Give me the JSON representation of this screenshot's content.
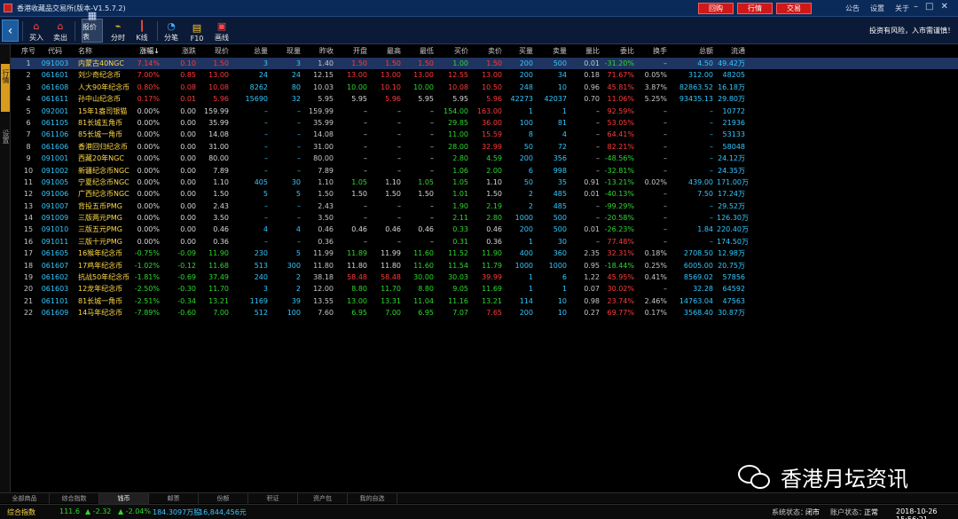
{
  "window": {
    "title": "香港收藏品交易所(版本-V1.5.7.2)",
    "top_buttons": [
      "回购",
      "行情",
      "交易"
    ],
    "menu_links": [
      "公告",
      "设置",
      "关于"
    ],
    "controls": [
      "–",
      "□",
      "✕"
    ]
  },
  "toolbar": {
    "back": "‹",
    "tools": [
      {
        "label": "买入",
        "icon": "buy-icon",
        "glyph": "⌂"
      },
      {
        "label": "卖出",
        "icon": "sell-icon",
        "glyph": "⌂"
      },
      {
        "label": "报价表",
        "icon": "quote-table-icon",
        "glyph": "▦"
      },
      {
        "label": "分时",
        "icon": "timeshare-icon",
        "glyph": "⌁"
      },
      {
        "label": "K线",
        "icon": "kline-icon",
        "glyph": "┃"
      },
      {
        "label": "分笔",
        "icon": "tick-icon",
        "glyph": "◔"
      },
      {
        "label": "F10",
        "icon": "f10-icon",
        "glyph": "▤"
      },
      {
        "label": "画线",
        "icon": "draw-line-icon",
        "glyph": "▣"
      }
    ],
    "risk_note": "投资有风险，入市需谨慎！"
  },
  "side_tabs": [
    "行情",
    "设置"
  ],
  "table": {
    "headers": [
      "序号",
      "代码",
      "名称",
      "涨幅↓",
      "涨跌",
      "现价",
      "总量",
      "现量",
      "昨收",
      "开盘",
      "最高",
      "最低",
      "买价",
      "卖价",
      "买量",
      "卖量",
      "量比",
      "委比",
      "换手",
      "总额",
      "流通"
    ],
    "rows": [
      [
        "1",
        "091003",
        "内蒙古40NGC",
        "7.14%",
        "0.10",
        "1.50",
        "3",
        "3",
        "1.40",
        "1.50",
        "1.50",
        "1.50",
        "1.00",
        "1.50",
        "200",
        "500",
        "0.01",
        "-31.20%",
        "–",
        "4.50",
        "49.42万"
      ],
      [
        "2",
        "061601",
        "刘少奇纪念币",
        "7.00%",
        "0.85",
        "13.00",
        "24",
        "24",
        "12.15",
        "13.00",
        "13.00",
        "13.00",
        "12.55",
        "13.00",
        "200",
        "34",
        "0.18",
        "71.67%",
        "0.05%",
        "312.00",
        "48205"
      ],
      [
        "3",
        "061608",
        "人大90年纪念币",
        "0.80%",
        "0.08",
        "10.08",
        "8262",
        "80",
        "10.03",
        "10.00",
        "10.10",
        "10.00",
        "10.08",
        "10.50",
        "248",
        "10",
        "0.96",
        "45.81%",
        "3.87%",
        "82863.52",
        "16.18万"
      ],
      [
        "4",
        "061611",
        "孙中山纪念币",
        "0.17%",
        "0.01",
        "5.96",
        "15690",
        "32",
        "5.95",
        "5.95",
        "5.96",
        "5.95",
        "5.95",
        "5.96",
        "42273",
        "42037",
        "0.70",
        "11.06%",
        "5.25%",
        "93435.13",
        "29.80万"
      ],
      [
        "5",
        "092001",
        "15年1盎司银猫",
        "0.00%",
        "0.00",
        "159.99",
        "–",
        "–",
        "159.99",
        "–",
        "–",
        "–",
        "154.00",
        "163.00",
        "1",
        "1",
        "–",
        "92.59%",
        "–",
        "–",
        "10772"
      ],
      [
        "6",
        "061105",
        "81长城五角币",
        "0.00%",
        "0.00",
        "35.99",
        "–",
        "–",
        "35.99",
        "–",
        "–",
        "–",
        "29.85",
        "36.00",
        "100",
        "81",
        "–",
        "53.05%",
        "–",
        "–",
        "21936"
      ],
      [
        "7",
        "061106",
        "85长城一角币",
        "0.00%",
        "0.00",
        "14.08",
        "–",
        "–",
        "14.08",
        "–",
        "–",
        "–",
        "11.00",
        "15.59",
        "8",
        "4",
        "–",
        "64.41%",
        "–",
        "–",
        "53133"
      ],
      [
        "8",
        "061606",
        "香港回归纪念币",
        "0.00%",
        "0.00",
        "31.00",
        "–",
        "–",
        "31.00",
        "–",
        "–",
        "–",
        "28.00",
        "32.99",
        "50",
        "72",
        "–",
        "82.21%",
        "–",
        "–",
        "58048"
      ],
      [
        "9",
        "091001",
        "西藏20年NGC",
        "0.00%",
        "0.00",
        "80.00",
        "–",
        "–",
        "80.00",
        "–",
        "–",
        "–",
        "2.80",
        "4.59",
        "200",
        "356",
        "–",
        "-48.56%",
        "–",
        "–",
        "24.12万"
      ],
      [
        "10",
        "091002",
        "新疆纪念币NGC",
        "0.00%",
        "0.00",
        "7.89",
        "–",
        "–",
        "7.89",
        "–",
        "–",
        "–",
        "1.06",
        "2.00",
        "6",
        "998",
        "–",
        "-32.81%",
        "–",
        "–",
        "24.35万"
      ],
      [
        "11",
        "091005",
        "宁夏纪念币NGC",
        "0.00%",
        "0.00",
        "1.10",
        "405",
        "30",
        "1.10",
        "1.05",
        "1.10",
        "1.05",
        "1.05",
        "1.10",
        "50",
        "35",
        "0.91",
        "-13.21%",
        "0.02%",
        "439.00",
        "171.00万"
      ],
      [
        "12",
        "091006",
        "广西纪念币NGC",
        "0.00%",
        "0.00",
        "1.50",
        "5",
        "5",
        "1.50",
        "1.50",
        "1.50",
        "1.50",
        "1.01",
        "1.50",
        "2",
        "485",
        "0.01",
        "-40.13%",
        "–",
        "7.50",
        "17.24万"
      ],
      [
        "13",
        "091007",
        "背投五币PMG",
        "0.00%",
        "0.00",
        "2.43",
        "–",
        "–",
        "2.43",
        "–",
        "–",
        "–",
        "1.90",
        "2.19",
        "2",
        "485",
        "–",
        "-99.29%",
        "–",
        "–",
        "29.52万"
      ],
      [
        "14",
        "091009",
        "三版两元PMG",
        "0.00%",
        "0.00",
        "3.50",
        "–",
        "–",
        "3.50",
        "–",
        "–",
        "–",
        "2.11",
        "2.80",
        "1000",
        "500",
        "–",
        "-20.58%",
        "–",
        "–",
        "126.30万"
      ],
      [
        "15",
        "091010",
        "三版五元PMG",
        "0.00%",
        "0.00",
        "0.46",
        "4",
        "4",
        "0.46",
        "0.46",
        "0.46",
        "0.46",
        "0.33",
        "0.46",
        "200",
        "500",
        "0.01",
        "-26.23%",
        "–",
        "1.84",
        "220.40万"
      ],
      [
        "16",
        "091011",
        "三版十元PMG",
        "0.00%",
        "0.00",
        "0.36",
        "–",
        "–",
        "0.36",
        "–",
        "–",
        "–",
        "0.31",
        "0.36",
        "1",
        "30",
        "–",
        "77.48%",
        "–",
        "–",
        "174.50万"
      ],
      [
        "17",
        "061605",
        "16猴年纪念币",
        "-0.75%",
        "-0.09",
        "11.90",
        "230",
        "5",
        "11.99",
        "11.89",
        "11.99",
        "11.60",
        "11.52",
        "11.90",
        "400",
        "360",
        "2.35",
        "32.31%",
        "0.18%",
        "2708.50",
        "12.98万"
      ],
      [
        "18",
        "061607",
        "17鸡年纪念币",
        "-1.02%",
        "-0.12",
        "11.68",
        "513",
        "300",
        "11.80",
        "11.80",
        "11.80",
        "11.60",
        "11.54",
        "11.79",
        "1000",
        "1000",
        "0.95",
        "-18.44%",
        "0.25%",
        "6005.00",
        "20.75万"
      ],
      [
        "19",
        "061602",
        "抗战50年纪念币",
        "-1.81%",
        "-0.69",
        "37.49",
        "240",
        "2",
        "38.18",
        "58.48",
        "58.48",
        "30.00",
        "30.03",
        "39.99",
        "1",
        "6",
        "1.22",
        "45.95%",
        "0.41%",
        "8569.02",
        "57856"
      ],
      [
        "20",
        "061603",
        "12龙年纪念币",
        "-2.50%",
        "-0.30",
        "11.70",
        "3",
        "2",
        "12.00",
        "8.80",
        "11.70",
        "8.80",
        "9.05",
        "11.69",
        "1",
        "1",
        "0.07",
        "30.02%",
        "–",
        "32.28",
        "64592"
      ],
      [
        "21",
        "061101",
        "81长城一角币",
        "-2.51%",
        "-0.34",
        "13.21",
        "1169",
        "39",
        "13.55",
        "13.00",
        "13.31",
        "11.04",
        "11.16",
        "13.21",
        "114",
        "10",
        "0.98",
        "23.74%",
        "2.46%",
        "14763.04",
        "47563"
      ],
      [
        "22",
        "061609",
        "14马年纪念币",
        "-7.89%",
        "-0.60",
        "7.00",
        "512",
        "100",
        "7.60",
        "6.95",
        "7.00",
        "6.95",
        "7.07",
        "7.65",
        "200",
        "10",
        "0.27",
        "69.77%",
        "0.17%",
        "3568.40",
        "30.87万"
      ]
    ]
  },
  "watermark": "香港月坛资讯",
  "bottom_tabs": [
    "全部商品",
    "综合指数",
    "钱币",
    "邮票",
    "份额",
    "积证",
    "资产包",
    "我的自选"
  ],
  "active_bottom_tab": "钱币",
  "status": {
    "index_name": "综合指数",
    "index_value": "111.6",
    "change": "▲ -2.32",
    "change_pct": "▲ -2.04%",
    "amount": "184.3097万股",
    "volume": "16,844,456元",
    "system_label": "系统状态：",
    "system_value": "闭市",
    "account_label": "账户状态：",
    "account_value": "正常",
    "datetime": "2018-10-26 15:56:21"
  },
  "colors": {
    "up": "#ff3b3b",
    "down": "#2fd82f",
    "code": "#33c8ff",
    "name": "#ffd84a",
    "selected_row": "#1f3460",
    "brand_button": "#d01818",
    "side_tab_active": "#d89b1c"
  }
}
